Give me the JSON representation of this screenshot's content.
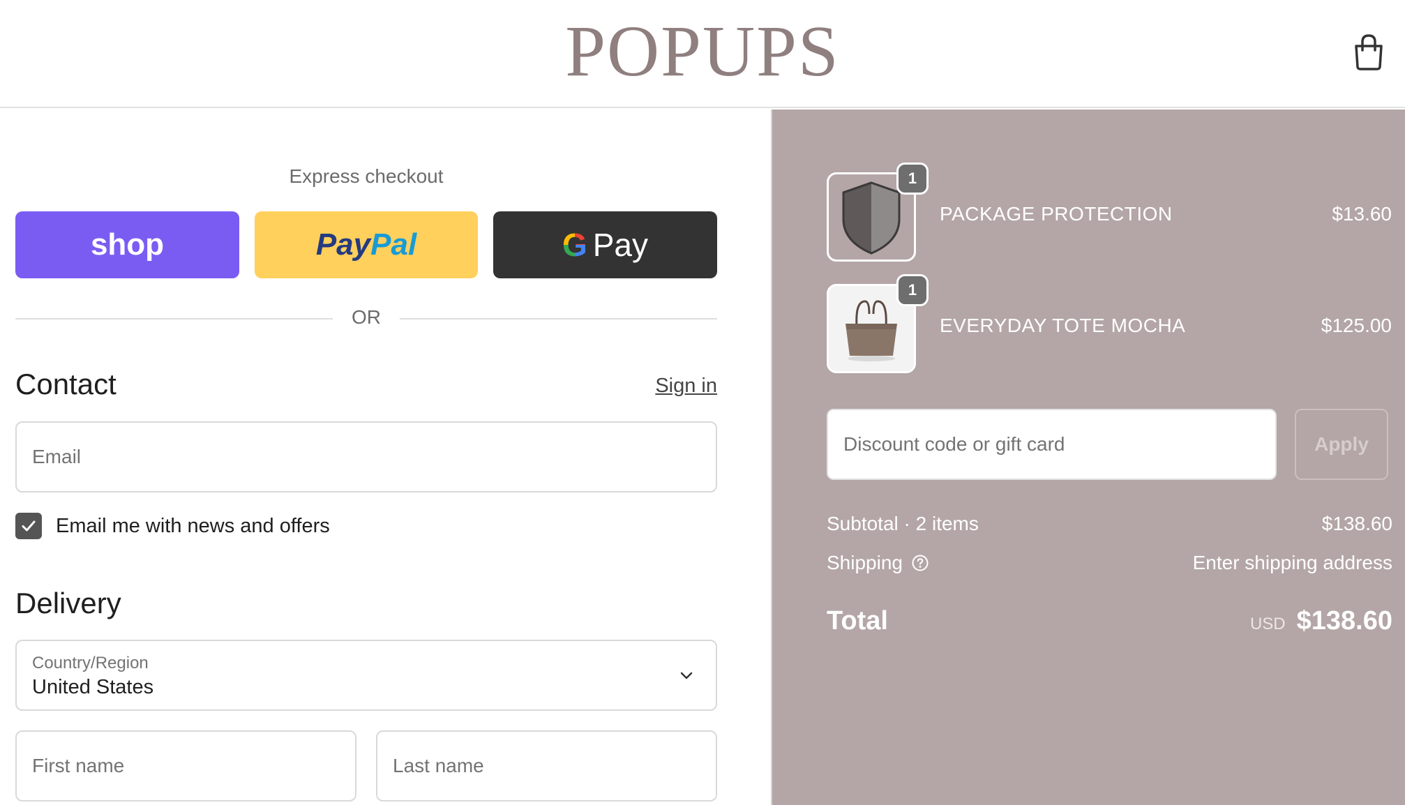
{
  "header": {
    "logo": "POPUPS",
    "cart_icon": "shopping-bag-icon"
  },
  "express": {
    "title": "Express checkout",
    "shop_label": "shop",
    "paypal_part1": "Pay",
    "paypal_part2": "Pal",
    "gpay_g": "G",
    "gpay_label": "Pay",
    "or_label": "OR"
  },
  "contact": {
    "title": "Contact",
    "signin_label": "Sign in",
    "email_placeholder": "Email",
    "newsletter_label": "Email me with news and offers",
    "newsletter_checked": true
  },
  "delivery": {
    "title": "Delivery",
    "country_caption": "Country/Region",
    "country_value": "United States",
    "first_name_placeholder": "First name",
    "last_name_placeholder": "Last name"
  },
  "order": {
    "items": [
      {
        "name": "PACKAGE PROTECTION",
        "price": "$13.60",
        "qty": "1",
        "image": "shield-icon"
      },
      {
        "name": "EVERYDAY TOTE MOCHA",
        "price": "$125.00",
        "qty": "1",
        "image": "tote-bag-image"
      }
    ],
    "discount_placeholder": "Discount code or gift card",
    "apply_label": "Apply",
    "subtotal_label": "Subtotal · 2 items",
    "subtotal_value": "$138.60",
    "shipping_label": "Shipping",
    "shipping_value": "Enter shipping address",
    "total_label": "Total",
    "currency": "USD",
    "total_value": "$138.60"
  },
  "colors": {
    "logo": "#8f7f7f",
    "summary_bg": "#b4a6a6",
    "shop_btn": "#7b5cf2",
    "paypal_btn": "#ffd05c",
    "gpay_btn": "#333333"
  }
}
